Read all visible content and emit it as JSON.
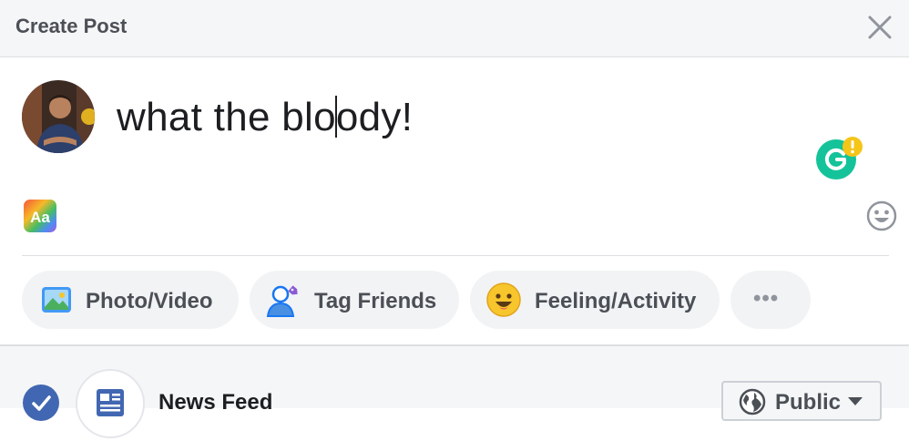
{
  "header": {
    "title": "Create Post"
  },
  "composer": {
    "text_before_caret": "what the blo",
    "text_after_caret": "ody!"
  },
  "actions": [
    {
      "label": "Photo/Video",
      "icon": "photo-icon"
    },
    {
      "label": "Tag Friends",
      "icon": "tag-friends-icon"
    },
    {
      "label": "Feeling/Activity",
      "icon": "feeling-icon"
    }
  ],
  "more": {
    "label": "•••"
  },
  "audience": {
    "destination": "News Feed",
    "privacy": "Public"
  },
  "colors": {
    "brand": "#4267b2",
    "grammarly": "#15c39a",
    "grammarly_alert": "#f5c518",
    "pill_bg": "#f2f3f5"
  }
}
